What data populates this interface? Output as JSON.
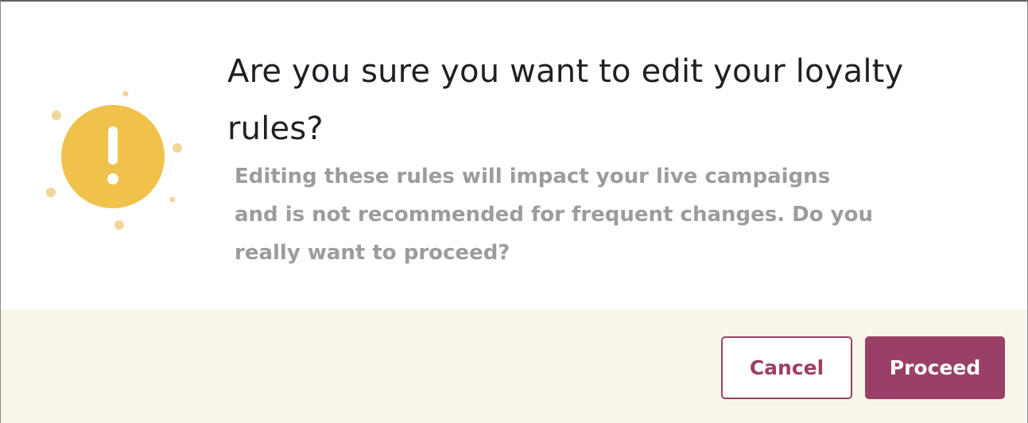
{
  "dialog": {
    "title": "Are you sure you want to edit your loyalty rules?",
    "message_lines": [
      "Editing these rules will impact your live campaigns",
      "and is not recommended for frequent changes. Do you",
      "really want to proceed?"
    ],
    "icon": "exclamation-warning-icon"
  },
  "actions": {
    "cancel_label": "Cancel",
    "proceed_label": "Proceed"
  },
  "colors": {
    "icon_fill": "#f0c24b",
    "icon_dots": "#f3d49a",
    "title_text": "#1f2024",
    "message_text": "#9c9c9c",
    "footer_bg": "#f8f6eb",
    "accent": "#9a3f66"
  }
}
